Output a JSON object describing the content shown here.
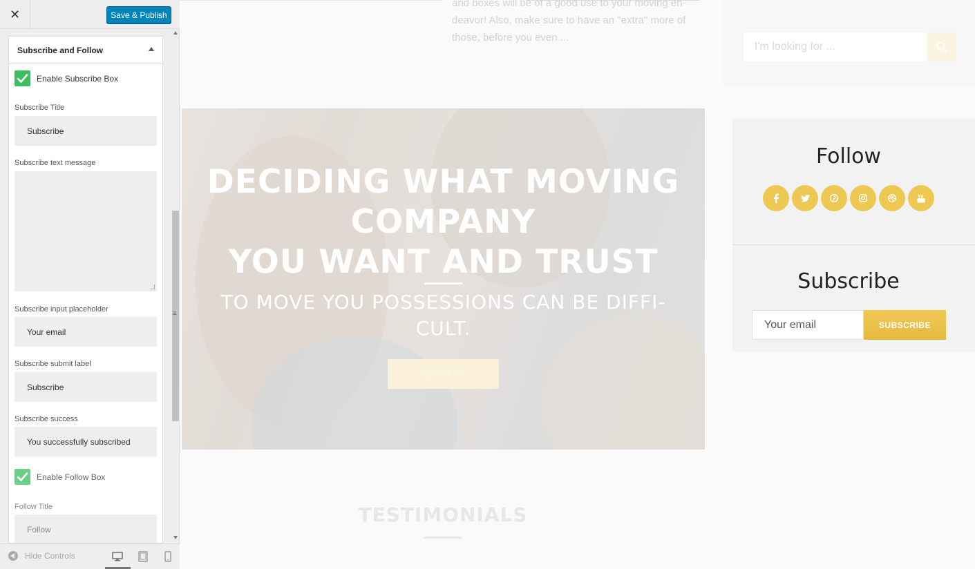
{
  "panel": {
    "close_label": "✕",
    "save_label": "Save & Publish",
    "section_title": "Subscribe and Follow",
    "enable_subscribe_label": "Enable Subscribe Box",
    "subscribe_title_label": "Subscribe Title",
    "subscribe_title_value": "Subscribe",
    "subscribe_text_label": "Subscribe text message",
    "subscribe_text_value": "",
    "subscribe_placeholder_label": "Subscribe input placeholder",
    "subscribe_placeholder_value": "Your email",
    "subscribe_submit_label": "Subscribe submit label",
    "subscribe_submit_value": "Subscribe",
    "subscribe_success_label": "Subscribe success",
    "subscribe_success_value": "You successfully subscribed",
    "enable_follow_label": "Enable Follow Box",
    "follow_title_label": "Follow Title",
    "follow_title_value": "Follow",
    "hide_controls_label": "Hide Controls",
    "accent_color": "#0085ba",
    "checkbox_color": "#3cc05f"
  },
  "preview": {
    "top_excerpt": "and boxes will be of a good use to your moving en-deavor! Also, make sure to have an \"extra\" more of those, before you even ...",
    "search_placeholder": "I'm looking for ...",
    "hero_title_line1": "DECIDING WHAT MOVING",
    "hero_title_line2": "COMPANY",
    "hero_title_line3": "YOU WANT AND TRUST",
    "hero_subtitle_line1": "TO MOVE YOU POSSESSIONS CAN BE DIFFI-",
    "hero_subtitle_line2": "CULT.",
    "hero_button_label": "ABOUT US",
    "follow_title": "Follow",
    "social_icons": [
      "facebook-icon",
      "twitter-icon",
      "pinterest-icon",
      "instagram-icon",
      "dribbble-icon",
      "youtube-icon"
    ],
    "subscribe_title": "Subscribe",
    "subscribe_placeholder": "Your email",
    "subscribe_button": "SUBSCRIBE",
    "testimonials_title": "TESTIMONIALS",
    "social_color": "#edc953",
    "button_color": "#e9be45"
  }
}
